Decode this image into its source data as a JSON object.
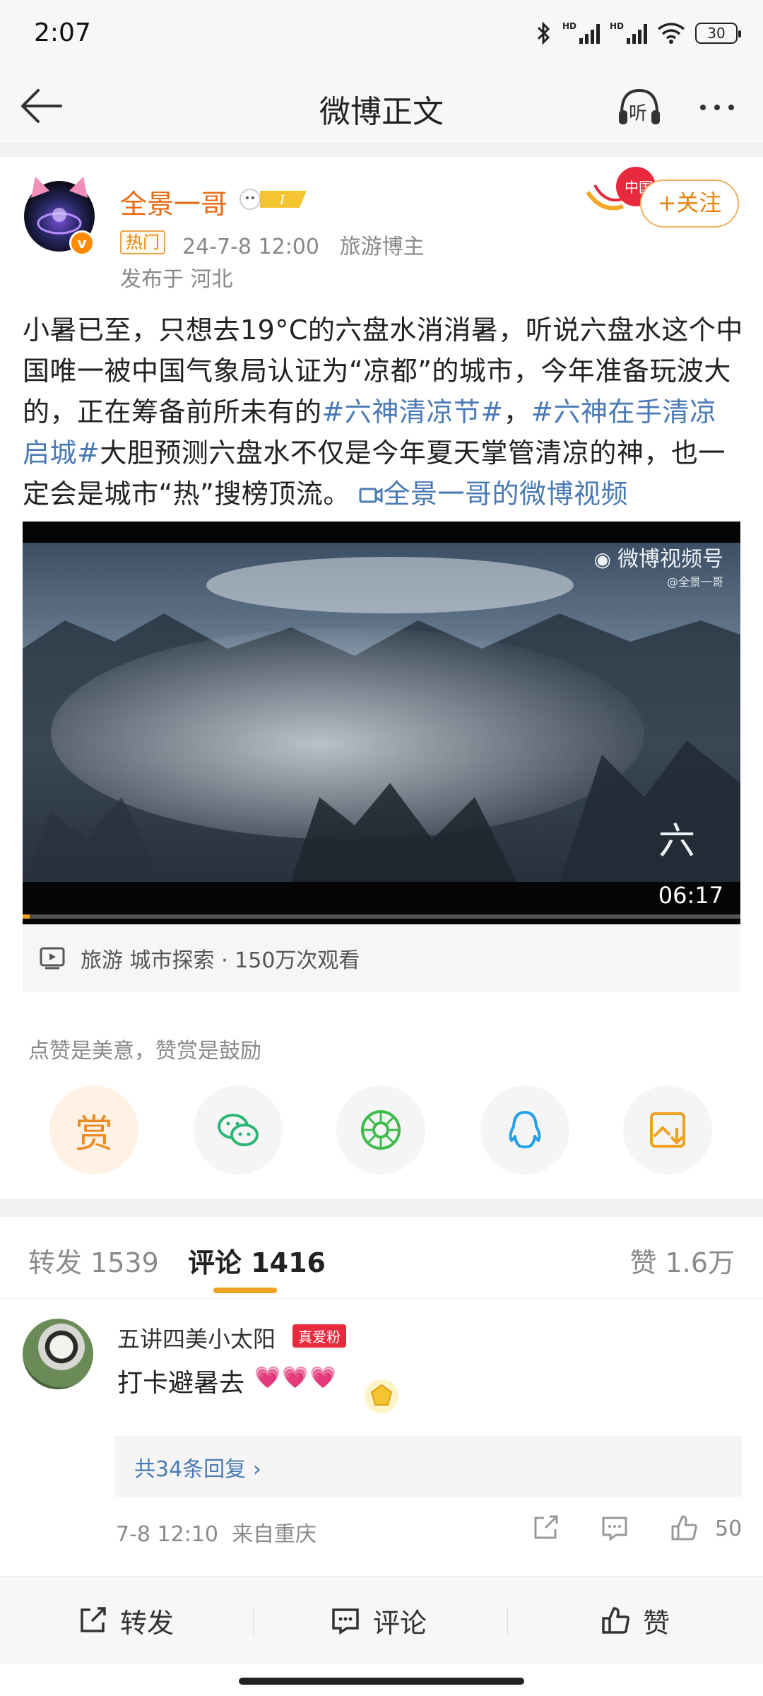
{
  "status_bar": {
    "time": "2:07",
    "battery": "30"
  },
  "nav": {
    "title": "微博正文",
    "listen_label": "听"
  },
  "post": {
    "author": "全景一哥",
    "hot_tag": "热门",
    "meta": "24-7-8 12:00   旅游博主",
    "location": "发布于 河北",
    "follow_label": "+关注",
    "body": {
      "p1": "小暑已至，只想去19°C的六盘水消消暑，听说六盘水这个中国唯一被中国气象局认证为“凉都”的城市，今年准备玩波大的，正在筹备前所未有的",
      "tag1": "#六神清凉节#",
      "p2": "，",
      "tag2": "#六神在手清凉启城#",
      "p3": "大胆预测六盘水不仅是今年夏天掌管清凉的神，也一定会是城市“热”搜榜顶流。",
      "video_link": "全景一哥的微博视频"
    },
    "video": {
      "watermark": "微博视频号",
      "watermark_sub": "@全景一哥",
      "duration": "06:17",
      "progress": 0.01,
      "info": "旅游 城市探索 · 150万次观看"
    }
  },
  "reward": {
    "caption": "点赞是美意，赞赏是鼓励",
    "reward_label": "赏"
  },
  "tabs": {
    "repost": "转发 1539",
    "comment": "评论 1416",
    "like": "赞 1.6万"
  },
  "comment": {
    "name": "五讲四美小太阳",
    "badge": "真爱粉",
    "text": "打卡避暑去",
    "hearts": "💗💗💗",
    "replies": "共34条回复 ›",
    "meta": "7-8 12:10  来自重庆",
    "likes": "50"
  },
  "bottom_bar": {
    "repost": "转发",
    "comment": "评论",
    "like": "赞"
  },
  "colors": {
    "accent": "#e8830c",
    "link": "#4a7ab5",
    "tab_indicator": "#f0a020"
  }
}
